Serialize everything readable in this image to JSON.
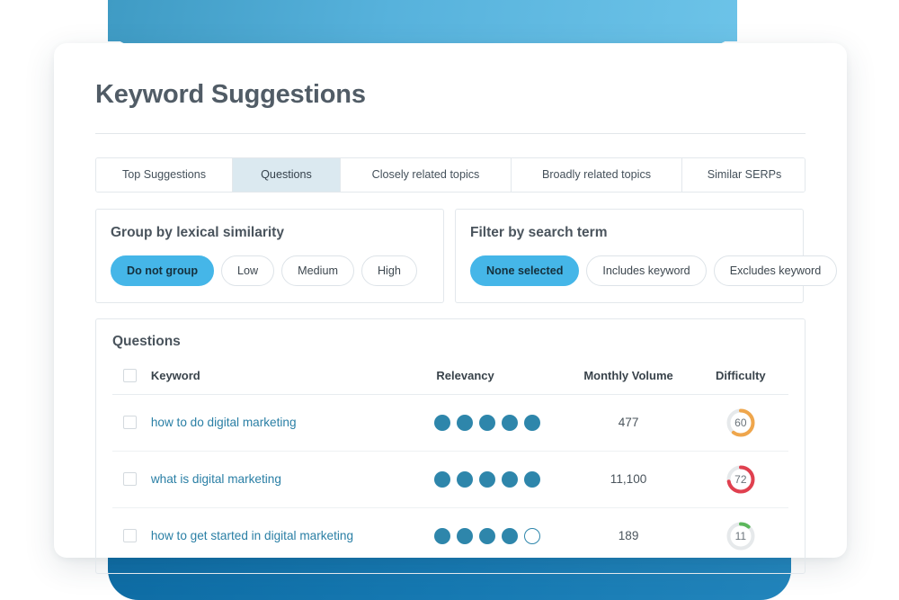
{
  "page": {
    "title": "Keyword Suggestions"
  },
  "colors": {
    "accent_blue": "#45b6e8",
    "link_blue": "#2a7fa5",
    "dot_blue": "#2e86ab",
    "active_tab_bg": "#dbe9f0",
    "difficulty_low": "#5cb85c",
    "difficulty_medium": "#efa64c",
    "difficulty_high": "#e0404f",
    "donut_track": "#e6e9eb",
    "top_shape": "#57b2dc",
    "bottom_shape": "#1679b2"
  },
  "tabs": [
    {
      "label": "Top Suggestions",
      "active": false
    },
    {
      "label": "Questions",
      "active": true
    },
    {
      "label": "Closely related topics",
      "active": false
    },
    {
      "label": "Broadly related topics",
      "active": false
    },
    {
      "label": "Similar SERPs",
      "active": false
    }
  ],
  "filters": {
    "group": {
      "title": "Group by lexical similarity",
      "options": [
        {
          "label": "Do not group",
          "active": true
        },
        {
          "label": "Low",
          "active": false
        },
        {
          "label": "Medium",
          "active": false
        },
        {
          "label": "High",
          "active": false
        }
      ]
    },
    "search_term": {
      "title": "Filter by search term",
      "options": [
        {
          "label": "None selected",
          "active": true
        },
        {
          "label": "Includes keyword",
          "active": false
        },
        {
          "label": "Excludes keyword",
          "active": false
        }
      ]
    }
  },
  "table": {
    "title": "Questions",
    "columns": {
      "keyword": "Keyword",
      "relevancy": "Relevancy",
      "volume": "Monthly Volume",
      "difficulty": "Difficulty"
    },
    "rows": [
      {
        "keyword": "how to do digital marketing",
        "relevancy_filled": 5,
        "relevancy_total": 5,
        "volume": "477",
        "difficulty": 60,
        "difficulty_label": "60",
        "difficulty_color": "#efa64c"
      },
      {
        "keyword": "what is digital marketing",
        "relevancy_filled": 5,
        "relevancy_total": 5,
        "volume": "11,100",
        "difficulty": 72,
        "difficulty_label": "72",
        "difficulty_color": "#e0404f"
      },
      {
        "keyword": "how to get started in digital marketing",
        "relevancy_filled": 4,
        "relevancy_total": 5,
        "volume": "189",
        "difficulty": 11,
        "difficulty_label": "11",
        "difficulty_color": "#5cb85c"
      }
    ]
  }
}
